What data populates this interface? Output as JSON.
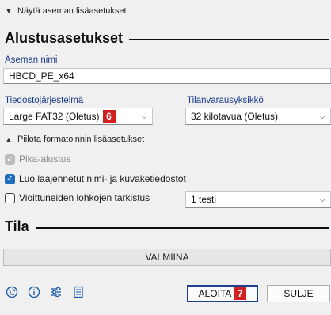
{
  "show_advanced_drive_label": "Näytä aseman lisäasetukset",
  "format_section": {
    "title": "Alustusasetukset"
  },
  "volume_label": {
    "label": "Aseman nimi",
    "value": "HBCD_PE_x64"
  },
  "filesystem": {
    "label": "Tiedostojärjestelmä",
    "value": "Large FAT32 (Oletus)",
    "badge": "6"
  },
  "cluster_size": {
    "label": "Tilanvarausyksikkö",
    "value": "32 kilotavua (Oletus)"
  },
  "hide_advanced_format_label": "Piilota formatoinnin lisäasetukset",
  "options": {
    "quick_format": {
      "label": "Pika-alustus",
      "checked": true,
      "disabled": true
    },
    "extended_label": {
      "label": "Luo laajennetut nimi- ja kuvaketiedostot",
      "checked": true
    },
    "bad_blocks": {
      "label": "Vioittuneiden lohkojen tarkistus",
      "checked": false
    },
    "passes": {
      "value": "1 testi"
    }
  },
  "status_section": {
    "title": "Tila",
    "status_text": "VALMIINA"
  },
  "buttons": {
    "start": "ALOITA",
    "start_badge": "7",
    "close": "SULJE"
  },
  "icons": [
    "globe-icon",
    "info-icon",
    "settings-sliders-icon",
    "log-icon"
  ],
  "colors": {
    "accent": "#1f6fbf",
    "badge": "#d21f1f",
    "label": "#1b3a8a"
  }
}
